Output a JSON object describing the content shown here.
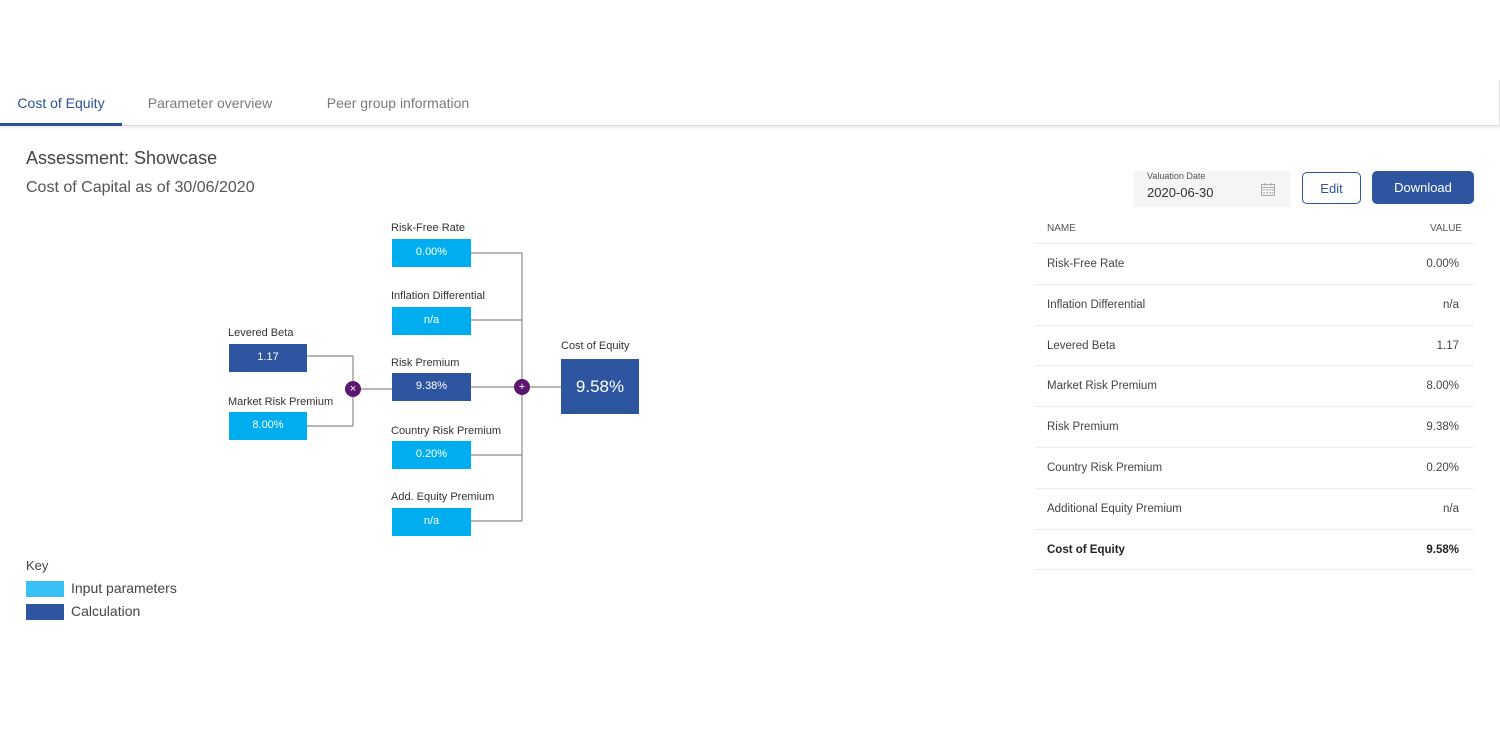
{
  "tabs": [
    {
      "label": "Cost of Equity",
      "active": true
    },
    {
      "label": "Parameter overview",
      "active": false
    },
    {
      "label": "Peer group information",
      "active": false
    }
  ],
  "header": {
    "title": "Assessment: Showcase",
    "subtitle": "Cost of Capital as of 30/06/2020"
  },
  "valuation_date": {
    "label": "Valuation Date",
    "value": "2020-06-30",
    "icon": "calendar-icon"
  },
  "buttons": {
    "edit": "Edit",
    "download": "Download"
  },
  "diagram": {
    "risk_free_rate": {
      "label": "Risk-Free Rate",
      "value": "0.00%"
    },
    "inflation_differential": {
      "label": "Inflation Differential",
      "value": "n/a"
    },
    "levered_beta": {
      "label": "Levered Beta",
      "value": "1.17"
    },
    "market_risk_premium": {
      "label": "Market Risk Premium",
      "value": "8.00%"
    },
    "risk_premium": {
      "label": "Risk Premium",
      "value": "9.38%"
    },
    "country_risk_premium": {
      "label": "Country Risk Premium",
      "value": "0.20%"
    },
    "add_equity_premium": {
      "label": "Add. Equity Premium",
      "value": "n/a"
    },
    "cost_of_equity": {
      "label": "Cost of Equity",
      "value": "9.58%"
    },
    "operators": {
      "multiply": "×",
      "add": "+"
    }
  },
  "key": {
    "title": "Key",
    "items": [
      {
        "label": "Input parameters",
        "color": "#38c1f2"
      },
      {
        "label": "Calculation",
        "color": "#2e55a0"
      }
    ]
  },
  "colors": {
    "input": "#00aeef",
    "calculation": "#2e55a0",
    "operator": "#5b1670",
    "accent": "#2a4f96"
  },
  "table": {
    "headers": {
      "name": "NAME",
      "value": "VALUE"
    },
    "rows": [
      {
        "name": "Risk-Free Rate",
        "value": "0.00%"
      },
      {
        "name": "Inflation Differential",
        "value": "n/a"
      },
      {
        "name": "Levered Beta",
        "value": "1.17"
      },
      {
        "name": "Market Risk Premium",
        "value": "8.00%"
      },
      {
        "name": "Risk Premium",
        "value": "9.38%"
      },
      {
        "name": "Country Risk Premium",
        "value": "0.20%"
      },
      {
        "name": "Additional Equity Premium",
        "value": "n/a"
      },
      {
        "name": "Cost of Equity",
        "value": "9.58%"
      }
    ]
  }
}
